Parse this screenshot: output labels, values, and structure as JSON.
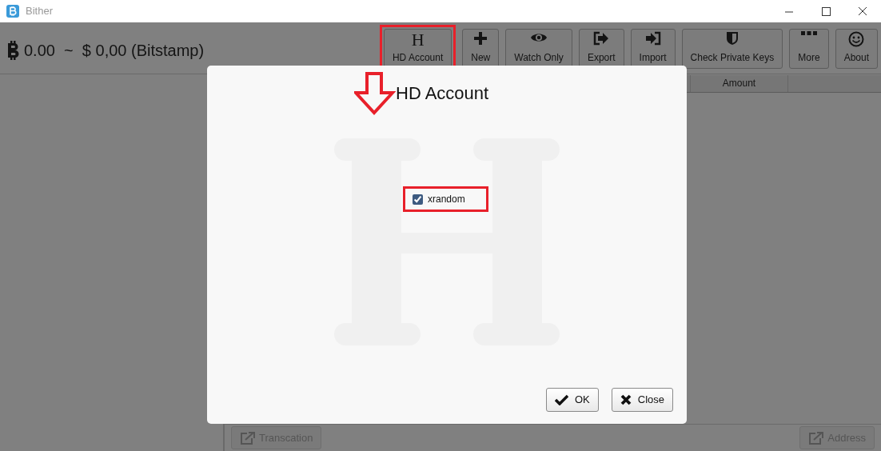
{
  "window": {
    "title": "Bither"
  },
  "balance": {
    "text": "0.00  ~  $ 0,00 (Bitstamp)"
  },
  "toolbar": [
    {
      "label": "HD Account",
      "kind": "letter",
      "glyph": "H",
      "highlighted": true
    },
    {
      "label": "New",
      "kind": "plus",
      "highlighted": false
    },
    {
      "label": "Watch Only",
      "kind": "eye",
      "highlighted": false
    },
    {
      "label": "Export",
      "kind": "export",
      "highlighted": false
    },
    {
      "label": "Import",
      "kind": "import",
      "highlighted": false
    },
    {
      "label": "Check Private Keys",
      "kind": "shield",
      "highlighted": false
    },
    {
      "label": "More",
      "kind": "dots",
      "highlighted": false
    },
    {
      "label": "About",
      "kind": "smiley",
      "highlighted": false
    }
  ],
  "table": {
    "columns": [
      "Amount"
    ]
  },
  "bottom_buttons": [
    {
      "label": "Transcation"
    },
    {
      "label": "Address"
    }
  ],
  "dialog": {
    "title": "HD Account",
    "pointer_arrow": true,
    "checkbox": {
      "label": "xrandom",
      "checked": true,
      "highlighted": true
    },
    "buttons": [
      {
        "label": "OK",
        "kind": "check"
      },
      {
        "label": "Close",
        "kind": "cross"
      }
    ]
  }
}
